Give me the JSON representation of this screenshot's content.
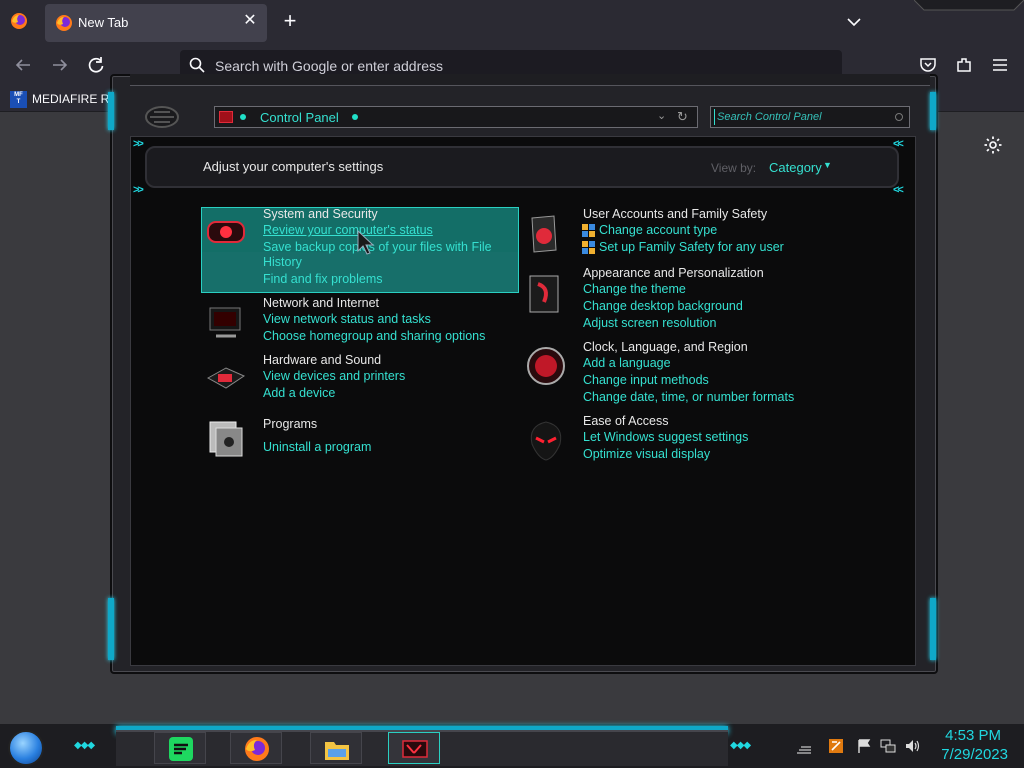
{
  "browser": {
    "tab": {
      "title": "New Tab",
      "close": "✕"
    },
    "new_tab": "+",
    "urlbar": {
      "placeholder": "Search with Google or enter address"
    },
    "bookmark": {
      "icon_text": "MF\nT",
      "label": "MEDIAFIRE RO"
    }
  },
  "control_panel": {
    "address": "Control Panel",
    "search_placeholder": "Search Control Panel",
    "heading": "Adjust your computer's settings",
    "view_by_label": "View by:",
    "view_by_value": "Category",
    "categories_left": [
      {
        "title": "System and Security",
        "links": [
          "Review your computer's status",
          "Save backup copies of your files with File",
          "History",
          "Find and fix problems"
        ]
      },
      {
        "title": "Network and Internet",
        "links": [
          "View network status and tasks",
          "Choose homegroup and sharing options"
        ]
      },
      {
        "title": "Hardware and Sound",
        "links": [
          "View devices and printers",
          "Add a device"
        ]
      },
      {
        "title": "Programs",
        "links": [
          "Uninstall a program"
        ]
      }
    ],
    "categories_right": [
      {
        "title": "User Accounts and Family Safety",
        "links": [
          "Change account type",
          "Set up Family Safety for any user"
        ]
      },
      {
        "title": "Appearance and Personalization",
        "links": [
          "Change the theme",
          "Change desktop background",
          "Adjust screen resolution"
        ]
      },
      {
        "title": "Clock, Language, and Region",
        "links": [
          "Add a language",
          "Change input methods",
          "Change date, time, or number formats"
        ]
      },
      {
        "title": "Ease of Access",
        "links": [
          "Let Windows suggest settings",
          "Optimize visual display"
        ]
      }
    ]
  },
  "taskbar": {
    "time": "4:53 PM",
    "date": "7/29/2023",
    "apps": [
      "spotify-icon",
      "firefox-icon",
      "file-explorer-icon",
      "control-panel-icon"
    ]
  },
  "colors": {
    "accent": "#35e0d0",
    "selection": "#136e67",
    "taskbar_accent": "#20d8e0"
  }
}
